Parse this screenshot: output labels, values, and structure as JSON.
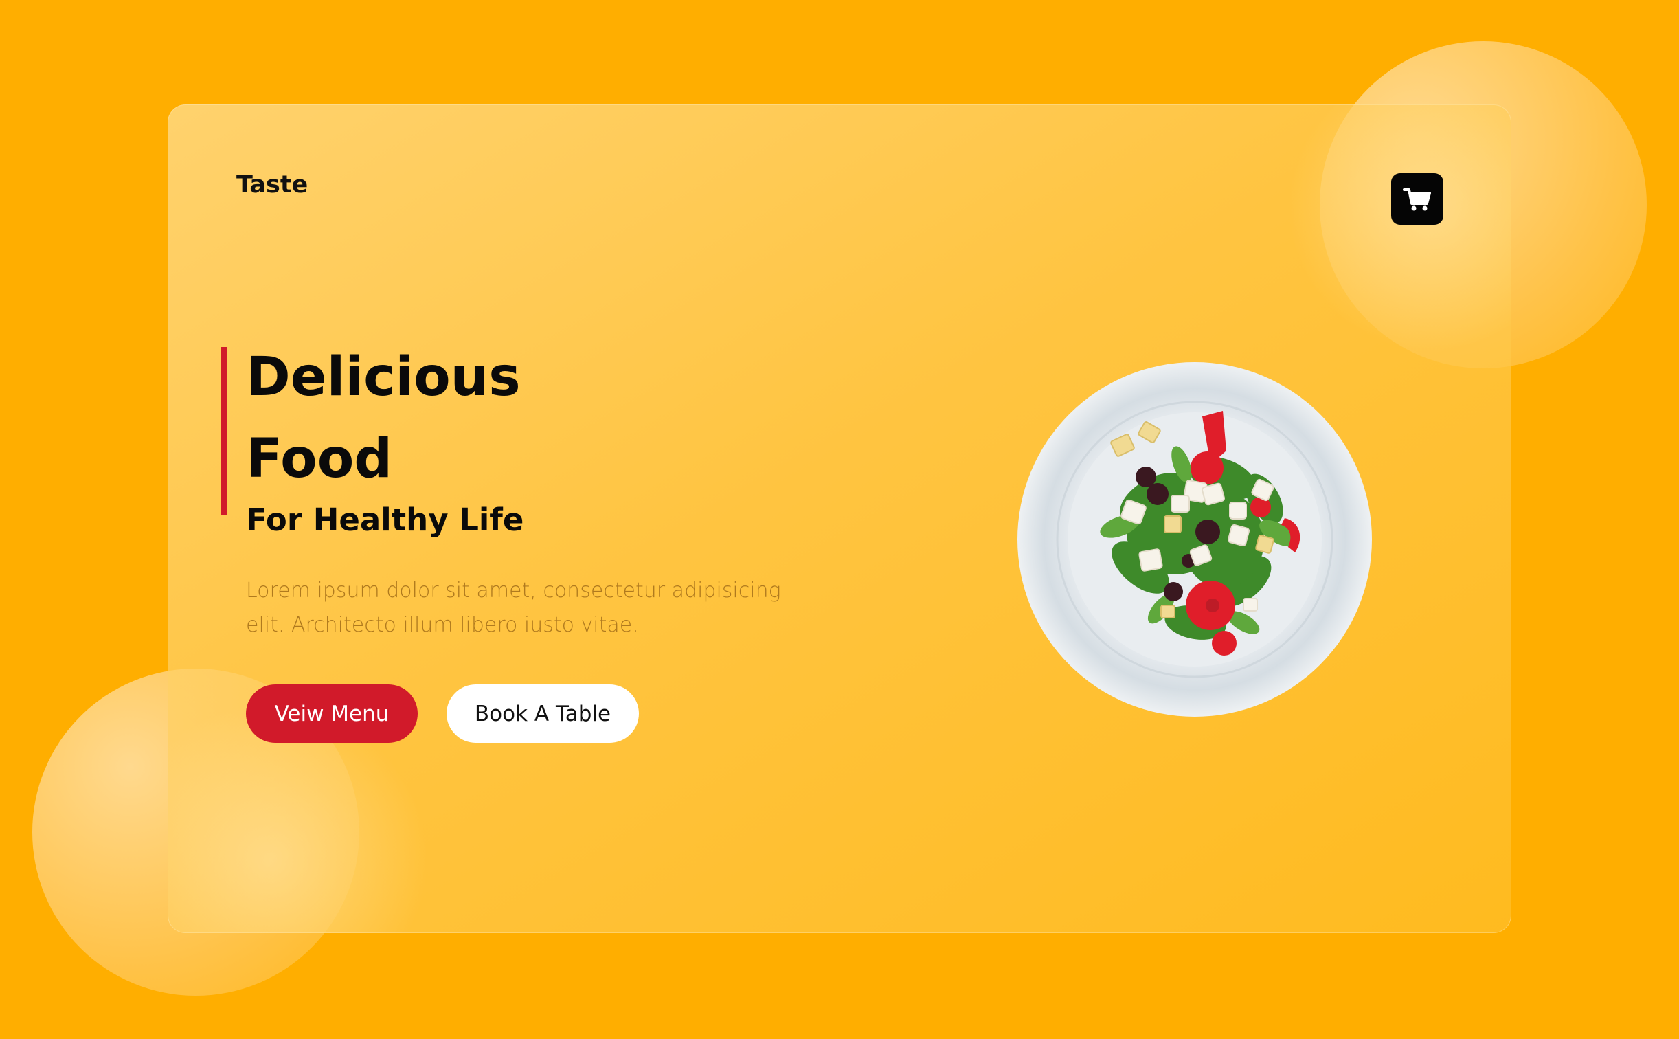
{
  "brand": {
    "name": "Taste"
  },
  "header": {
    "cart_icon": "shopping-cart-icon"
  },
  "hero": {
    "title_line1": "Delicious",
    "title_line2": "Food",
    "subtitle": "For Healthy Life",
    "description": "Lorem ipsum dolor sit amet, consectetur adipisicing elit. Architecto illum libero iusto vitae."
  },
  "buttons": {
    "menu_label": "Veiw Menu",
    "book_label": "Book A Table"
  },
  "colors": {
    "background": "#FFAE00",
    "accent_red": "#D11A2A",
    "cart_button": "#050505",
    "text_dark": "#0A0A0A"
  },
  "image": {
    "icon": "salad-plate-image"
  }
}
